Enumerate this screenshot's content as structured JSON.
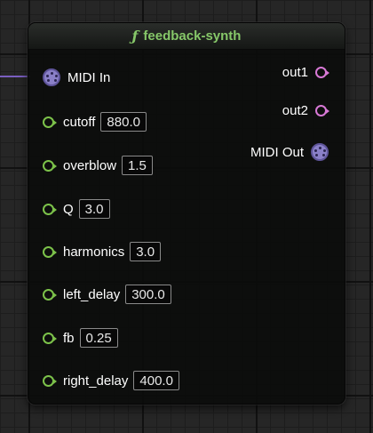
{
  "node": {
    "title": "feedback-synth",
    "title_icon": "function-icon",
    "header_color": "#86c769"
  },
  "inputs": [
    {
      "label": "MIDI In",
      "type": "midi"
    },
    {
      "label": "cutoff",
      "value": "880.0"
    },
    {
      "label": "overblow",
      "value": "1.5"
    },
    {
      "label": "Q",
      "value": "3.0"
    },
    {
      "label": "harmonics",
      "value": "3.0"
    },
    {
      "label": "left_delay",
      "value": "300.0"
    },
    {
      "label": "fb",
      "value": "0.25"
    },
    {
      "label": "right_delay",
      "value": "400.0"
    }
  ],
  "outputs": [
    {
      "label": "out1",
      "type": "audio"
    },
    {
      "label": "out2",
      "type": "audio"
    },
    {
      "label": "MIDI Out",
      "type": "midi"
    }
  ],
  "colors": {
    "float_pin": "#7cc24a",
    "audio_pin": "#d879d6",
    "midi_pin": "#8a80c8",
    "wire": "#7a5fc0"
  }
}
